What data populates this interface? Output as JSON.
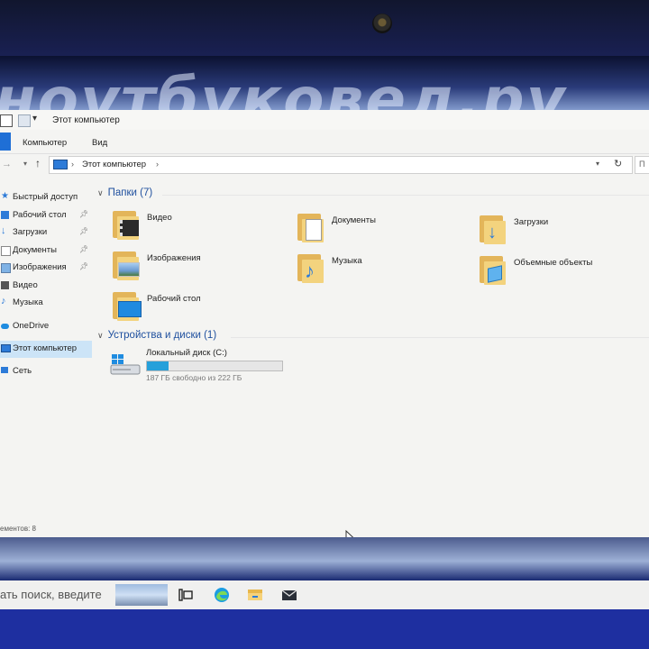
{
  "window": {
    "title": "Этот компьютер",
    "ribbon_tabs": [
      "Компьютер",
      "Вид"
    ],
    "address_path": "Этот компьютер",
    "search_placeholder": "П"
  },
  "sidebar": {
    "items": [
      {
        "label": "Быстрый доступ"
      },
      {
        "label": "Рабочий стол"
      },
      {
        "label": "Загрузки"
      },
      {
        "label": "Документы"
      },
      {
        "label": "Изображения"
      },
      {
        "label": "Видео"
      },
      {
        "label": "Музыка"
      },
      {
        "label": "OneDrive"
      },
      {
        "label": "Этот компьютер"
      },
      {
        "label": "Сеть"
      }
    ]
  },
  "content": {
    "folders_header": "Папки (7)",
    "folders": [
      {
        "label": "Видео",
        "icon": "video-folder-icon"
      },
      {
        "label": "Документы",
        "icon": "documents-folder-icon"
      },
      {
        "label": "Загрузки",
        "icon": "downloads-folder-icon"
      },
      {
        "label": "Изображения",
        "icon": "pictures-folder-icon"
      },
      {
        "label": "Музыка",
        "icon": "music-folder-icon"
      },
      {
        "label": "Объемные объекты",
        "icon": "3d-objects-folder-icon"
      },
      {
        "label": "Рабочий стол",
        "icon": "desktop-folder-icon"
      }
    ],
    "devices_header": "Устройства и диски (1)",
    "drive": {
      "name": "Локальный диск (C:)",
      "free_text": "187 ГБ свободно из 222 ГБ",
      "used_fraction": 0.158
    }
  },
  "status": {
    "items_text": "ементов: 8"
  },
  "taskbar": {
    "search_text": "ать поиск, введите"
  },
  "wallpaper": {
    "text": "ноутбуковед.ру"
  },
  "colors": {
    "accent": "#1f6fd6",
    "selection": "#cce4f7",
    "drive_fill": "#26a0da",
    "group_header": "#1e4f9e"
  }
}
